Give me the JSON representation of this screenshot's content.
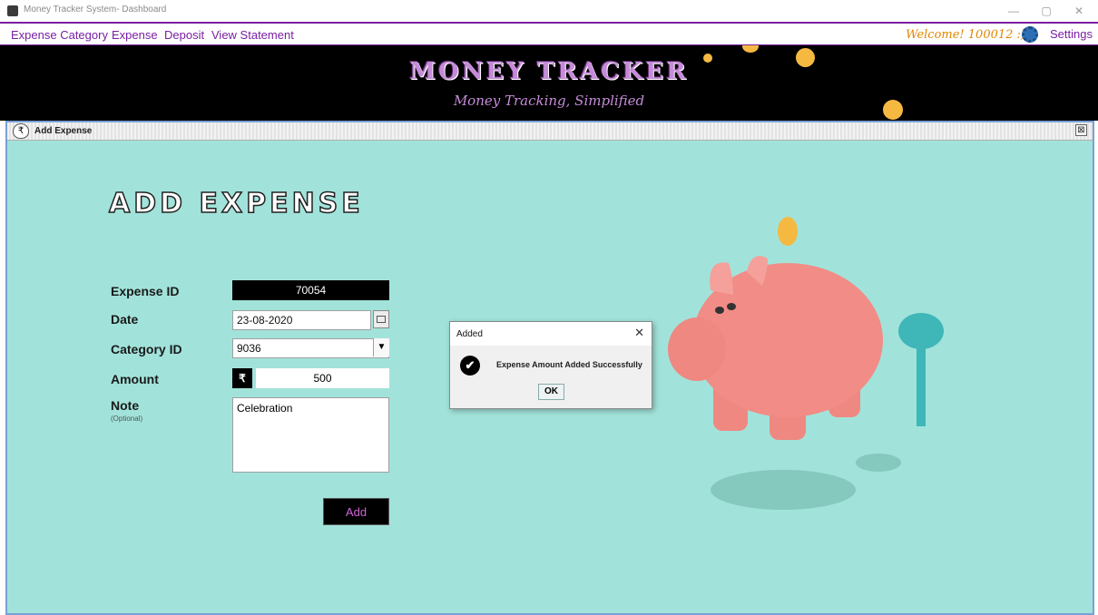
{
  "window": {
    "title": "Money Tracker System- Dashboard",
    "minimize": "—",
    "maximize": "▢",
    "close": "✕"
  },
  "menu": {
    "items": [
      "Expense Category",
      "Expense",
      "Deposit",
      "View Statement"
    ],
    "welcome": "Welcome! 100012 :)",
    "settings": "Settings"
  },
  "banner": {
    "title": "MONEY TRACKER",
    "subtitle": "Money Tracking, Simplified"
  },
  "frame": {
    "title": "Add Expense",
    "close_symbol": "⊠"
  },
  "form": {
    "heading": "ADD EXPENSE",
    "expense_id_label": "Expense ID",
    "expense_id_value": "70054",
    "date_label": "Date",
    "date_value": "23-08-2020",
    "category_label": "Category ID",
    "category_value": "9036",
    "amount_label": "Amount",
    "currency_symbol": "₹",
    "amount_value": "500",
    "note_label": "Note",
    "note_optional": "(Optional)",
    "note_value": "Celebration",
    "add_button": "Add"
  },
  "dialog": {
    "title": "Added",
    "message": "Expense Amount Added Successfully",
    "ok_button": "OK",
    "close_symbol": "✕",
    "icon_glyph": "✔"
  },
  "colors": {
    "accent": "#7a1fa2",
    "background": "#a1e3da",
    "welcome": "#e08600"
  }
}
